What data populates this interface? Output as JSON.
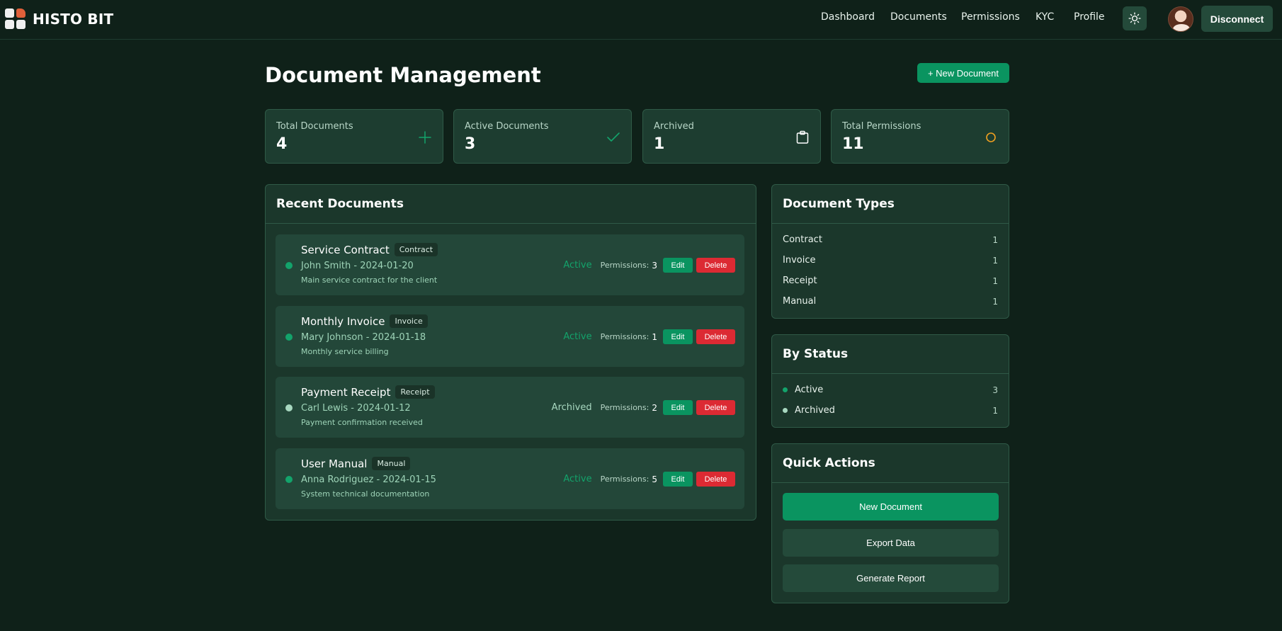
{
  "app": {
    "name": "HISTO BIT"
  },
  "nav": {
    "items": [
      "Dashboard",
      "Documents",
      "Permissions",
      "KYC",
      "Profile"
    ],
    "disconnect_label": "Disconnect"
  },
  "page": {
    "title": "Document Management",
    "new_button": "+ New Document"
  },
  "stats": [
    {
      "label": "Total Documents",
      "value": "4",
      "icon": "plus-icon"
    },
    {
      "label": "Active Documents",
      "value": "3",
      "icon": "check-icon"
    },
    {
      "label": "Archived",
      "value": "1",
      "icon": "clipboard-icon"
    },
    {
      "label": "Total Permissions",
      "value": "11",
      "icon": "circle-icon"
    }
  ],
  "recent": {
    "title": "Recent Documents",
    "permissions_label": "Permissions:",
    "edit_label": "Edit",
    "delete_label": "Delete",
    "items": [
      {
        "title": "Service Contract",
        "type": "Contract",
        "meta": "John Smith - 2024-01-20",
        "desc": "Main service contract for the client",
        "status": "Active",
        "permissions": "3"
      },
      {
        "title": "Monthly Invoice",
        "type": "Invoice",
        "meta": "Mary Johnson - 2024-01-18",
        "desc": "Monthly service billing",
        "status": "Active",
        "permissions": "1"
      },
      {
        "title": "Payment Receipt",
        "type": "Receipt",
        "meta": "Carl Lewis - 2024-01-12",
        "desc": "Payment confirmation received",
        "status": "Archived",
        "permissions": "2"
      },
      {
        "title": "User Manual",
        "type": "Manual",
        "meta": "Anna Rodriguez - 2024-01-15",
        "desc": "System technical documentation",
        "status": "Active",
        "permissions": "5"
      }
    ]
  },
  "doc_types": {
    "title": "Document Types",
    "items": [
      {
        "label": "Contract",
        "count": "1"
      },
      {
        "label": "Invoice",
        "count": "1"
      },
      {
        "label": "Receipt",
        "count": "1"
      },
      {
        "label": "Manual",
        "count": "1"
      }
    ]
  },
  "by_status": {
    "title": "By Status",
    "items": [
      {
        "label": "Active",
        "count": "3"
      },
      {
        "label": "Archived",
        "count": "1"
      }
    ]
  },
  "quick_actions": {
    "title": "Quick Actions",
    "buttons": [
      "New Document",
      "Export Data",
      "Generate Report"
    ]
  },
  "colors": {
    "background": "#0f2119",
    "accent": "#0a9460",
    "danger": "#dc2a33",
    "active_status": "#13a36b",
    "archived_status": "#a8d8c0",
    "warning_icon": "#f0a020"
  }
}
